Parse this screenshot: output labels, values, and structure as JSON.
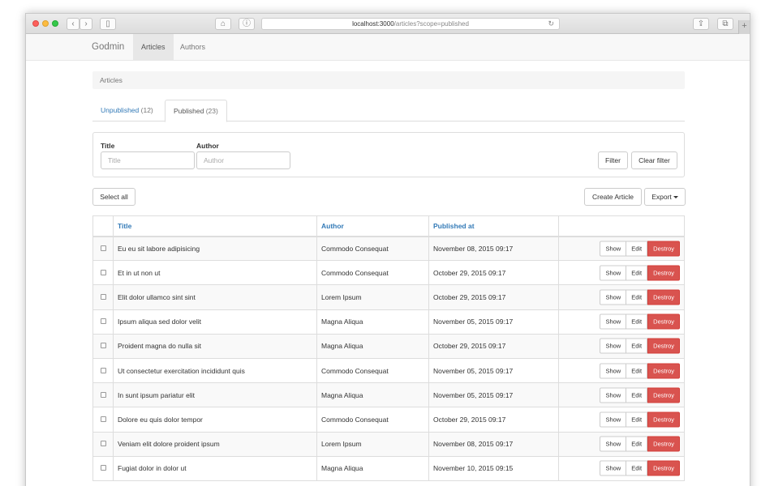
{
  "browser": {
    "url_host": "localhost:3000",
    "url_path": "/articles?scope=published",
    "back_icon": "‹",
    "forward_icon": "›",
    "sidebar_icon": "▯",
    "home_icon": "⌂",
    "info_icon": "ⓘ",
    "reload_icon": "↻",
    "share_icon": "⇪",
    "tabs_icon": "⧉",
    "newtab_icon": "+"
  },
  "navbar": {
    "brand": "Godmin",
    "links": [
      {
        "label": "Articles",
        "active": true
      },
      {
        "label": "Authors",
        "active": false
      }
    ]
  },
  "breadcrumb": "Articles",
  "scopes": [
    {
      "label": "Unpublished",
      "count": "(12)",
      "active": false
    },
    {
      "label": "Published",
      "count": "(23)",
      "active": true
    }
  ],
  "filter": {
    "title_label": "Title",
    "title_placeholder": "Title",
    "author_label": "Author",
    "author_placeholder": "Author",
    "filter_button": "Filter",
    "clear_button": "Clear filter"
  },
  "toolbar": {
    "select_all": "Select all",
    "create": "Create Article",
    "export": "Export"
  },
  "table": {
    "columns": [
      "Title",
      "Author",
      "Published at"
    ],
    "action_labels": {
      "show": "Show",
      "edit": "Edit",
      "destroy": "Destroy"
    },
    "rows": [
      {
        "title": "Eu eu sit labore adipisicing",
        "author": "Commodo Consequat",
        "published": "November 08, 2015 09:17"
      },
      {
        "title": "Et in ut non ut",
        "author": "Commodo Consequat",
        "published": "October 29, 2015 09:17"
      },
      {
        "title": "Elit dolor ullamco sint sint",
        "author": "Lorem Ipsum",
        "published": "October 29, 2015 09:17"
      },
      {
        "title": "Ipsum aliqua sed dolor velit",
        "author": "Magna Aliqua",
        "published": "November 05, 2015 09:17"
      },
      {
        "title": "Proident magna do nulla sit",
        "author": "Magna Aliqua",
        "published": "October 29, 2015 09:17"
      },
      {
        "title": "Ut consectetur exercitation incididunt quis",
        "author": "Commodo Consequat",
        "published": "November 05, 2015 09:17"
      },
      {
        "title": "In sunt ipsum pariatur elit",
        "author": "Magna Aliqua",
        "published": "November 05, 2015 09:17"
      },
      {
        "title": "Dolore eu quis dolor tempor",
        "author": "Commodo Consequat",
        "published": "October 29, 2015 09:17"
      },
      {
        "title": "Veniam elit dolore proident ipsum",
        "author": "Lorem Ipsum",
        "published": "November 08, 2015 09:17"
      },
      {
        "title": "Fugiat dolor in dolor ut",
        "author": "Magna Aliqua",
        "published": "November 10, 2015 09:15"
      }
    ]
  }
}
